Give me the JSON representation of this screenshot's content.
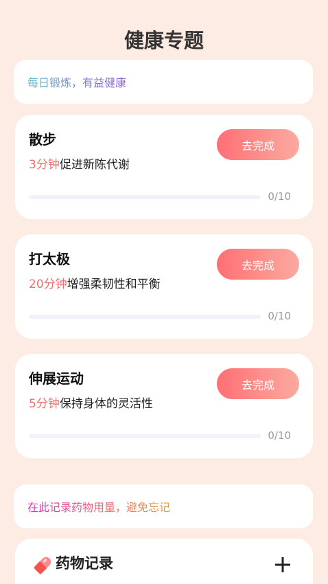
{
  "page": {
    "title": "健康专题"
  },
  "exercise_banner": {
    "text": "每日锻炼，有益健康"
  },
  "tasks": [
    {
      "title": "散步",
      "duration": "3分钟",
      "description": "促进新陈代谢",
      "button": "去完成",
      "progress_done": 0,
      "progress_total": 10,
      "progress_text": "0/10"
    },
    {
      "title": "打太极",
      "duration": "20分钟",
      "description": "增强柔韧性和平衡",
      "button": "去完成",
      "progress_done": 0,
      "progress_total": 10,
      "progress_text": "0/10"
    },
    {
      "title": "伸展运动",
      "duration": "5分钟",
      "description": "保持身体的灵活性",
      "button": "去完成",
      "progress_done": 0,
      "progress_total": 10,
      "progress_text": "0/10"
    }
  ],
  "medicine_banner": {
    "text": "在此记录药物用量，避免忘记"
  },
  "medicine_card": {
    "title": "药物记录",
    "icon": "pill-icon",
    "add_icon": "plus-icon"
  },
  "colors": {
    "background": "#fcece4",
    "accent": "#f06d6d",
    "button_gradient_start": "#ff6f74",
    "button_gradient_end": "#fbaaa0"
  }
}
